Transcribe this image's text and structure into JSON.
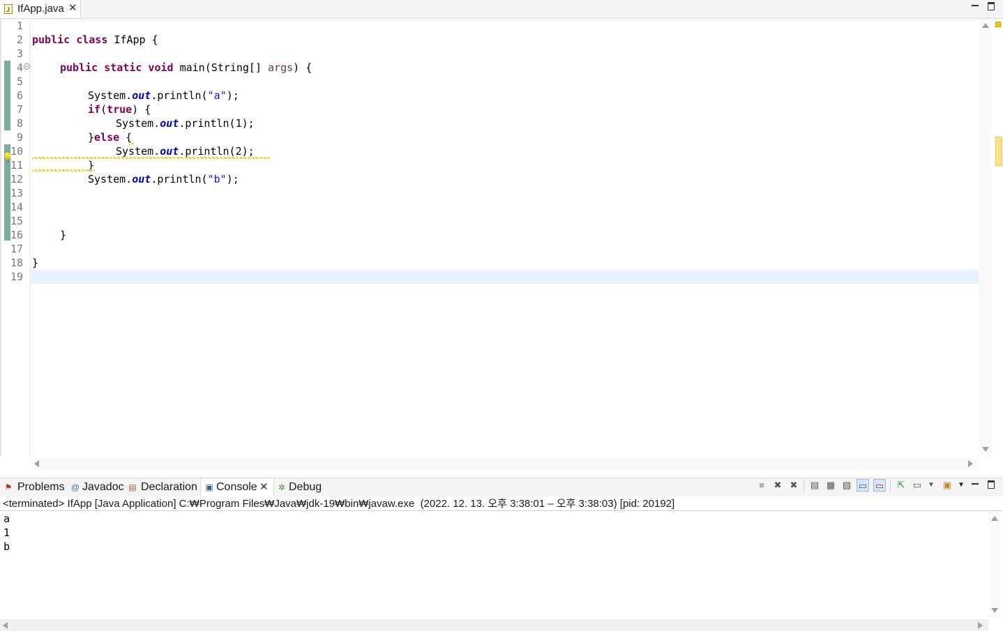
{
  "editor": {
    "tab_label": "IfApp.java",
    "tab_close": "✕",
    "line_numbers": [
      "1",
      "2",
      "3",
      "4",
      "5",
      "6",
      "7",
      "8",
      "9",
      "10",
      "11",
      "12",
      "13",
      "14",
      "15",
      "16",
      "17",
      "18",
      "19"
    ],
    "code": {
      "l2_kw": "public class",
      "l2_rest": " IfApp {",
      "l4_kw": "public static void",
      "l4_mid": " main(String[] ",
      "l4_param": "args",
      "l4_end": ") {",
      "l6_a": "System.",
      "l6_fld": "out",
      "l6_b": ".println(",
      "l6_str": "\"a\"",
      "l6_c": ");",
      "l7_kw1": "if",
      "l7_p": "(",
      "l7_kw2": "true",
      "l7_end": ") {",
      "l8_a": "System.",
      "l8_fld": "out",
      "l8_b": ".println(1);",
      "l9_brace": "}",
      "l9_kw": "else",
      "l9_end": " {",
      "l10_a": "System.",
      "l10_fld": "out",
      "l10_b": ".println(2);",
      "l11": "}",
      "l12_a": "System.",
      "l12_fld": "out",
      "l12_b": ".println(",
      "l12_str": "\"b\"",
      "l12_c": ");",
      "l16": "}",
      "l18": "}"
    }
  },
  "views": {
    "tabs": [
      {
        "label": "Problems"
      },
      {
        "label": "Javadoc"
      },
      {
        "label": "Declaration"
      },
      {
        "label": "Console"
      },
      {
        "label": "Debug"
      }
    ],
    "close_glyph": "✕"
  },
  "console": {
    "description": "<terminated> IfApp [Java Application] C:₩Program Files₩Java₩jdk-19₩bin₩javaw.exe  (2022. 12. 13. 오후 3:38:01 – 오후 3:38:03) [pid: 20192]",
    "output": [
      "a",
      "1",
      "b"
    ]
  },
  "colors": {
    "keyword": "#7f0055",
    "field": "#0000c0",
    "string": "#2a00ff",
    "parameter": "#6a3e3e",
    "current_line": "#e8f2fe",
    "quick_diff": "#79ad9d"
  }
}
